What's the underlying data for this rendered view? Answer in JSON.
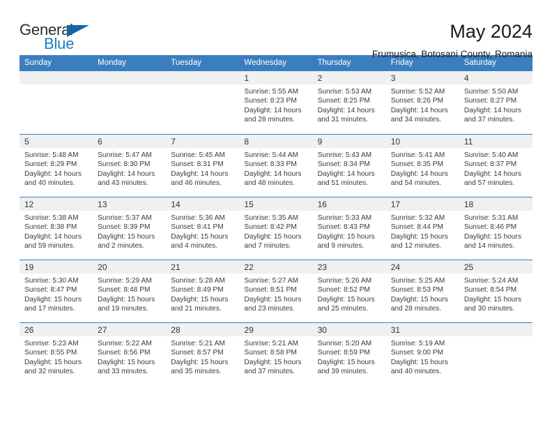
{
  "brand": {
    "name_top": "General",
    "name_bottom": "Blue",
    "triangle_color": "#1565a8",
    "text_color": "#2b2b2b",
    "accent_color": "#1b7cc2"
  },
  "header": {
    "title": "May 2024",
    "subtitle": "Frumusica, Botosani County, Romania",
    "header_bg": "#3a7ebf",
    "daynum_bg": "#f0f0f0"
  },
  "calendar": {
    "weekday_headers": [
      "Sunday",
      "Monday",
      "Tuesday",
      "Wednesday",
      "Thursday",
      "Friday",
      "Saturday"
    ],
    "weeks": [
      [
        {
          "day": "",
          "empty": true
        },
        {
          "day": "",
          "empty": true
        },
        {
          "day": "",
          "empty": true
        },
        {
          "day": "1",
          "sunrise": "Sunrise: 5:55 AM",
          "sunset": "Sunset: 8:23 PM",
          "daylight1": "Daylight: 14 hours",
          "daylight2": "and 28 minutes."
        },
        {
          "day": "2",
          "sunrise": "Sunrise: 5:53 AM",
          "sunset": "Sunset: 8:25 PM",
          "daylight1": "Daylight: 14 hours",
          "daylight2": "and 31 minutes."
        },
        {
          "day": "3",
          "sunrise": "Sunrise: 5:52 AM",
          "sunset": "Sunset: 8:26 PM",
          "daylight1": "Daylight: 14 hours",
          "daylight2": "and 34 minutes."
        },
        {
          "day": "4",
          "sunrise": "Sunrise: 5:50 AM",
          "sunset": "Sunset: 8:27 PM",
          "daylight1": "Daylight: 14 hours",
          "daylight2": "and 37 minutes."
        }
      ],
      [
        {
          "day": "5",
          "sunrise": "Sunrise: 5:48 AM",
          "sunset": "Sunset: 8:29 PM",
          "daylight1": "Daylight: 14 hours",
          "daylight2": "and 40 minutes."
        },
        {
          "day": "6",
          "sunrise": "Sunrise: 5:47 AM",
          "sunset": "Sunset: 8:30 PM",
          "daylight1": "Daylight: 14 hours",
          "daylight2": "and 43 minutes."
        },
        {
          "day": "7",
          "sunrise": "Sunrise: 5:45 AM",
          "sunset": "Sunset: 8:31 PM",
          "daylight1": "Daylight: 14 hours",
          "daylight2": "and 46 minutes."
        },
        {
          "day": "8",
          "sunrise": "Sunrise: 5:44 AM",
          "sunset": "Sunset: 8:33 PM",
          "daylight1": "Daylight: 14 hours",
          "daylight2": "and 48 minutes."
        },
        {
          "day": "9",
          "sunrise": "Sunrise: 5:43 AM",
          "sunset": "Sunset: 8:34 PM",
          "daylight1": "Daylight: 14 hours",
          "daylight2": "and 51 minutes."
        },
        {
          "day": "10",
          "sunrise": "Sunrise: 5:41 AM",
          "sunset": "Sunset: 8:35 PM",
          "daylight1": "Daylight: 14 hours",
          "daylight2": "and 54 minutes."
        },
        {
          "day": "11",
          "sunrise": "Sunrise: 5:40 AM",
          "sunset": "Sunset: 8:37 PM",
          "daylight1": "Daylight: 14 hours",
          "daylight2": "and 57 minutes."
        }
      ],
      [
        {
          "day": "12",
          "sunrise": "Sunrise: 5:38 AM",
          "sunset": "Sunset: 8:38 PM",
          "daylight1": "Daylight: 14 hours",
          "daylight2": "and 59 minutes."
        },
        {
          "day": "13",
          "sunrise": "Sunrise: 5:37 AM",
          "sunset": "Sunset: 8:39 PM",
          "daylight1": "Daylight: 15 hours",
          "daylight2": "and 2 minutes."
        },
        {
          "day": "14",
          "sunrise": "Sunrise: 5:36 AM",
          "sunset": "Sunset: 8:41 PM",
          "daylight1": "Daylight: 15 hours",
          "daylight2": "and 4 minutes."
        },
        {
          "day": "15",
          "sunrise": "Sunrise: 5:35 AM",
          "sunset": "Sunset: 8:42 PM",
          "daylight1": "Daylight: 15 hours",
          "daylight2": "and 7 minutes."
        },
        {
          "day": "16",
          "sunrise": "Sunrise: 5:33 AM",
          "sunset": "Sunset: 8:43 PM",
          "daylight1": "Daylight: 15 hours",
          "daylight2": "and 9 minutes."
        },
        {
          "day": "17",
          "sunrise": "Sunrise: 5:32 AM",
          "sunset": "Sunset: 8:44 PM",
          "daylight1": "Daylight: 15 hours",
          "daylight2": "and 12 minutes."
        },
        {
          "day": "18",
          "sunrise": "Sunrise: 5:31 AM",
          "sunset": "Sunset: 8:46 PM",
          "daylight1": "Daylight: 15 hours",
          "daylight2": "and 14 minutes."
        }
      ],
      [
        {
          "day": "19",
          "sunrise": "Sunrise: 5:30 AM",
          "sunset": "Sunset: 8:47 PM",
          "daylight1": "Daylight: 15 hours",
          "daylight2": "and 17 minutes."
        },
        {
          "day": "20",
          "sunrise": "Sunrise: 5:29 AM",
          "sunset": "Sunset: 8:48 PM",
          "daylight1": "Daylight: 15 hours",
          "daylight2": "and 19 minutes."
        },
        {
          "day": "21",
          "sunrise": "Sunrise: 5:28 AM",
          "sunset": "Sunset: 8:49 PM",
          "daylight1": "Daylight: 15 hours",
          "daylight2": "and 21 minutes."
        },
        {
          "day": "22",
          "sunrise": "Sunrise: 5:27 AM",
          "sunset": "Sunset: 8:51 PM",
          "daylight1": "Daylight: 15 hours",
          "daylight2": "and 23 minutes."
        },
        {
          "day": "23",
          "sunrise": "Sunrise: 5:26 AM",
          "sunset": "Sunset: 8:52 PM",
          "daylight1": "Daylight: 15 hours",
          "daylight2": "and 25 minutes."
        },
        {
          "day": "24",
          "sunrise": "Sunrise: 5:25 AM",
          "sunset": "Sunset: 8:53 PM",
          "daylight1": "Daylight: 15 hours",
          "daylight2": "and 28 minutes."
        },
        {
          "day": "25",
          "sunrise": "Sunrise: 5:24 AM",
          "sunset": "Sunset: 8:54 PM",
          "daylight1": "Daylight: 15 hours",
          "daylight2": "and 30 minutes."
        }
      ],
      [
        {
          "day": "26",
          "sunrise": "Sunrise: 5:23 AM",
          "sunset": "Sunset: 8:55 PM",
          "daylight1": "Daylight: 15 hours",
          "daylight2": "and 32 minutes."
        },
        {
          "day": "27",
          "sunrise": "Sunrise: 5:22 AM",
          "sunset": "Sunset: 8:56 PM",
          "daylight1": "Daylight: 15 hours",
          "daylight2": "and 33 minutes."
        },
        {
          "day": "28",
          "sunrise": "Sunrise: 5:21 AM",
          "sunset": "Sunset: 8:57 PM",
          "daylight1": "Daylight: 15 hours",
          "daylight2": "and 35 minutes."
        },
        {
          "day": "29",
          "sunrise": "Sunrise: 5:21 AM",
          "sunset": "Sunset: 8:58 PM",
          "daylight1": "Daylight: 15 hours",
          "daylight2": "and 37 minutes."
        },
        {
          "day": "30",
          "sunrise": "Sunrise: 5:20 AM",
          "sunset": "Sunset: 8:59 PM",
          "daylight1": "Daylight: 15 hours",
          "daylight2": "and 39 minutes."
        },
        {
          "day": "31",
          "sunrise": "Sunrise: 5:19 AM",
          "sunset": "Sunset: 9:00 PM",
          "daylight1": "Daylight: 15 hours",
          "daylight2": "and 40 minutes."
        },
        {
          "day": "",
          "empty": true
        }
      ]
    ]
  }
}
